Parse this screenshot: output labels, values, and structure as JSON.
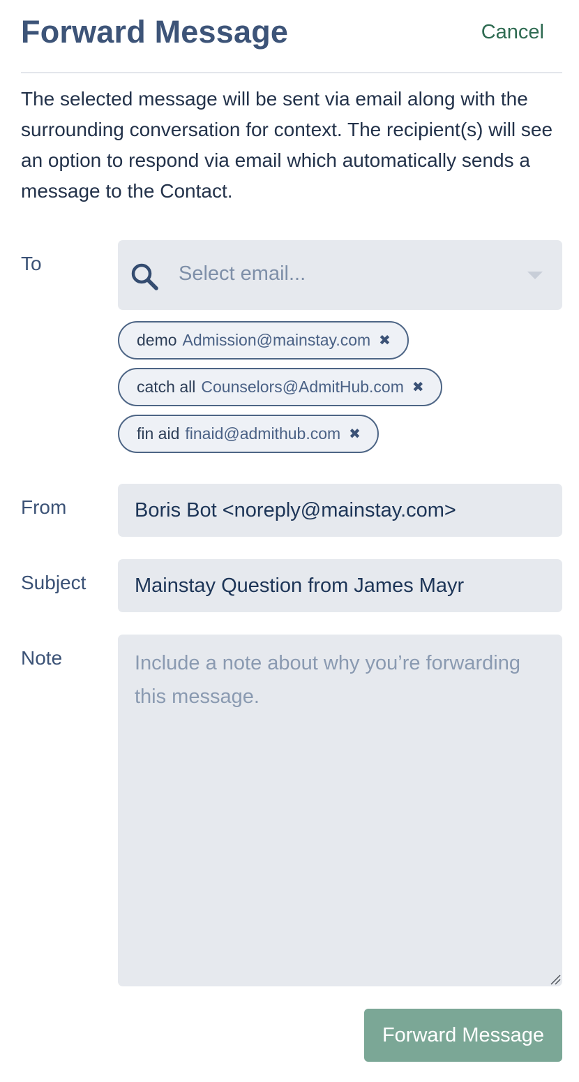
{
  "header": {
    "title": "Forward Message",
    "cancel_label": "Cancel"
  },
  "description": "The selected message will be sent via email along with the surrounding conversation for context. The recipient(s) will see an option to respond via email which automatically sends a message to the Contact.",
  "form": {
    "to": {
      "label": "To",
      "placeholder": "Select email...",
      "icon": "search-icon",
      "dropdown_icon": "caret-down-icon",
      "recipients": [
        {
          "name": "demo",
          "email": "Admission@mainstay.com"
        },
        {
          "name": "catch all",
          "email": "Counselors@AdmitHub.com"
        },
        {
          "name": "fin aid",
          "email": "finaid@admithub.com"
        }
      ],
      "remove_glyph": "✖"
    },
    "from": {
      "label": "From",
      "value": "Boris Bot <noreply@mainstay.com>"
    },
    "subject": {
      "label": "Subject",
      "value": "Mainstay Question from James Mayr"
    },
    "note": {
      "label": "Note",
      "placeholder": "Include a note about why you’re forwarding this message.",
      "value": ""
    },
    "submit_label": "Forward Message"
  },
  "colors": {
    "title": "#3d5478",
    "cancel": "#2f6b52",
    "field_bg": "#e6e9ee",
    "chip_border": "#4d6585",
    "submit_bg": "#7ba796"
  }
}
